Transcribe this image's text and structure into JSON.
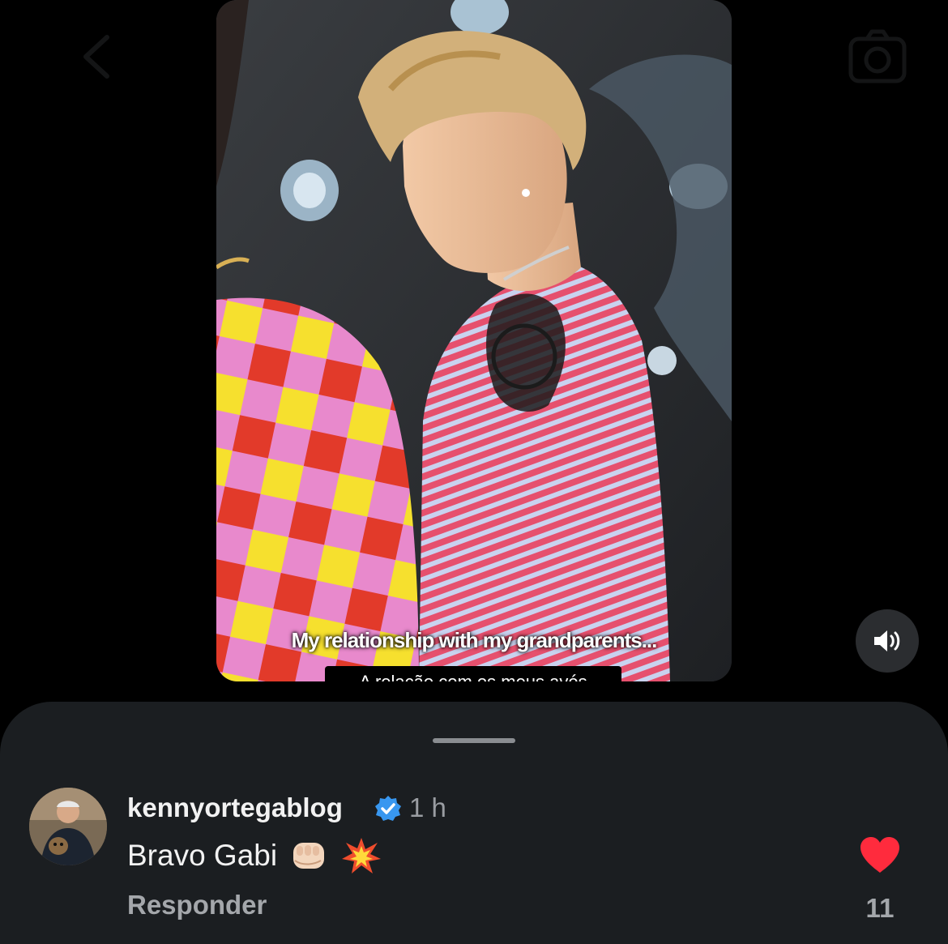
{
  "video": {
    "subtitle_en": "My relationship with my grandparents...",
    "subtitle_pt": "A relação com os meus avós"
  },
  "controls": {
    "back_icon": "chevron-left-icon",
    "camera_icon": "camera-icon",
    "volume_icon": "speaker-icon"
  },
  "comment": {
    "username": "kennyortegablog",
    "verified": true,
    "time": "1 h",
    "text": "Bravo Gabi",
    "emojis": [
      "fist-icon",
      "collision-icon"
    ],
    "reply_label": "Responder",
    "likes": "11",
    "liked": true
  },
  "colors": {
    "sheet_bg": "#1b1e21",
    "heart": "#ff2b3d",
    "verified": "#3897f0"
  }
}
